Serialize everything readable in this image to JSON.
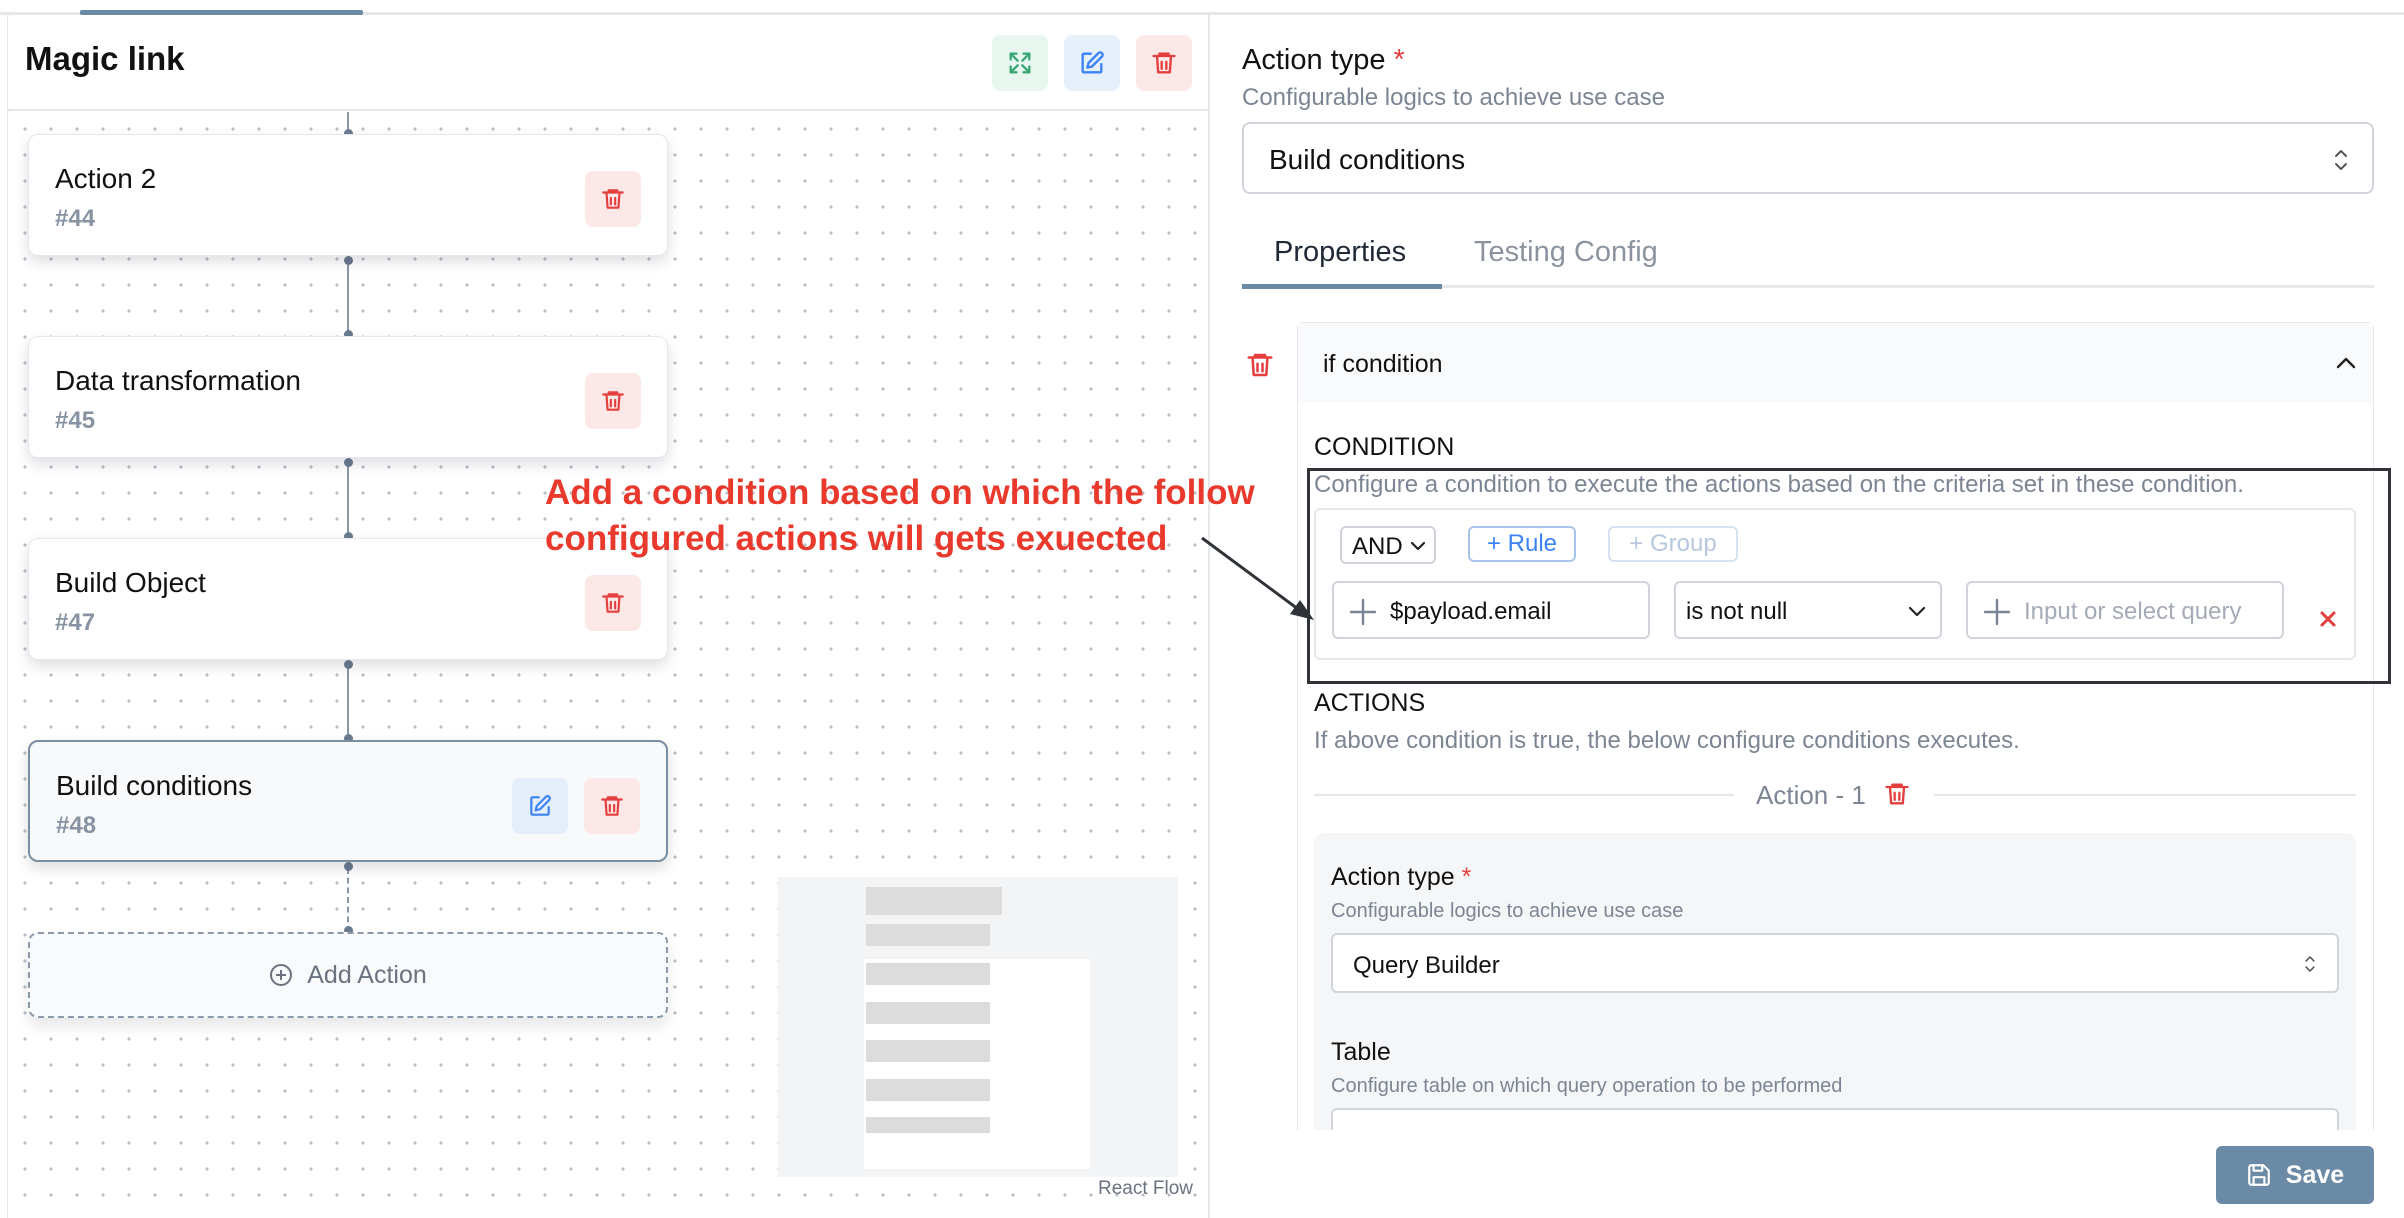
{
  "header": {
    "title": "Magic link"
  },
  "nodes": [
    {
      "title": "Action 2",
      "id": "#44"
    },
    {
      "title": "Data transformation",
      "id": "#45"
    },
    {
      "title": "Build Object",
      "id": "#47"
    },
    {
      "title": "Build conditions",
      "id": "#48"
    }
  ],
  "add_action_label": "Add Action",
  "annotation": {
    "line1": "Add a condition based on which the follow",
    "line2": "configured actions will gets exuected"
  },
  "react_flow_label": "React Flow",
  "panel": {
    "action_type_label": "Action type",
    "required_mark": "*",
    "action_type_desc": "Configurable logics to achieve use case",
    "action_type_value": "Build conditions",
    "tabs": [
      "Properties",
      "Testing Config"
    ],
    "if_condition_label": "if condition",
    "condition": {
      "title": "CONDITION",
      "desc": "Configure a condition to execute the actions based on the criteria set in these condition.",
      "combinator": "AND",
      "add_rule": "+ Rule",
      "add_group": "+ Group",
      "field_value": "$payload.email",
      "operator": "is not null",
      "value_placeholder": "Input or select query"
    },
    "actions": {
      "title": "ACTIONS",
      "desc": "If above condition is true, the below configure conditions executes.",
      "action_label": "Action - 1",
      "inner_action_type_label": "Action type",
      "inner_action_type_desc": "Configurable logics to achieve use case",
      "inner_action_type_value": "Query Builder",
      "table_label": "Table",
      "table_desc": "Configure table on which query operation to be performed"
    },
    "save_label": "Save"
  },
  "colors": {
    "accent": "#6b8aa6",
    "danger": "#e53e3e",
    "annotation": "#e8392c",
    "link": "#3b82f6"
  }
}
